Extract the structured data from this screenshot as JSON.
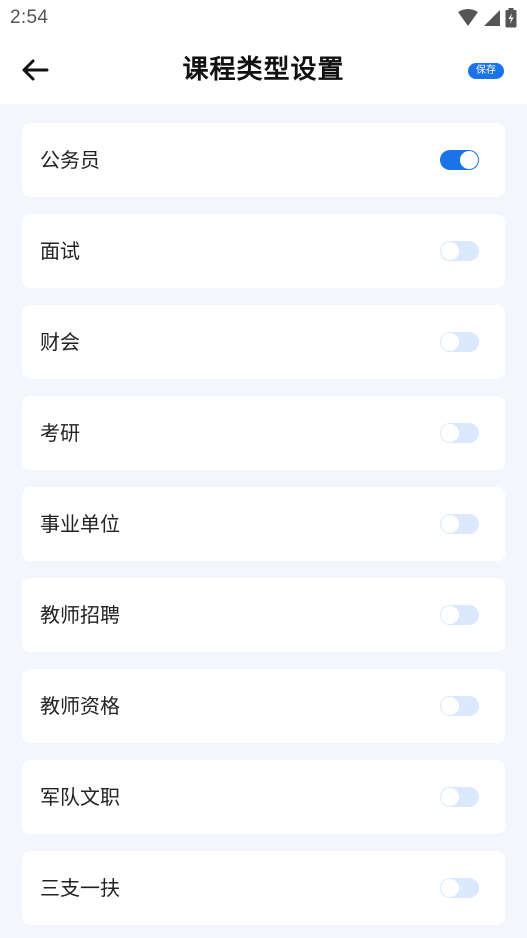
{
  "status_bar": {
    "time": "2:54"
  },
  "header": {
    "title": "课程类型设置",
    "save_label": "保存"
  },
  "items": [
    {
      "label": "公务员",
      "enabled": true
    },
    {
      "label": "面试",
      "enabled": false
    },
    {
      "label": "财会",
      "enabled": false
    },
    {
      "label": "考研",
      "enabled": false
    },
    {
      "label": "事业单位",
      "enabled": false
    },
    {
      "label": "教师招聘",
      "enabled": false
    },
    {
      "label": "教师资格",
      "enabled": false
    },
    {
      "label": "军队文职",
      "enabled": false
    },
    {
      "label": "三支一扶",
      "enabled": false
    }
  ],
  "colors": {
    "accent": "#1a73e8",
    "toggle_off": "#dbe8fe",
    "background": "#f3f6fd"
  },
  "icons": {
    "back": "arrow-left-icon",
    "wifi": "wifi-icon",
    "signal": "signal-icon",
    "battery": "battery-charging-icon"
  }
}
